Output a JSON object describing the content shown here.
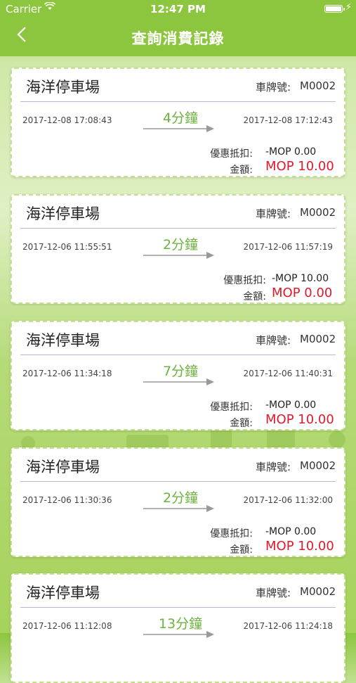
{
  "status": {
    "carrier": "Carrier",
    "time": "12:47 PM"
  },
  "nav": {
    "title": "查詢消費記錄",
    "back_icon": "chevron-left-icon"
  },
  "labels": {
    "plate": "車牌號:",
    "discount": "優惠抵扣:",
    "amount": "金額:"
  },
  "colors": {
    "brand": "#8cc63f",
    "duration": "#6db33f",
    "amount": "#e2182b"
  },
  "records": [
    {
      "name": "海洋停車場",
      "plate": "M0002",
      "start": "2017-12-08 17:08:43",
      "end": "2017-12-08 17:12:43",
      "duration": "4分鐘",
      "discount": "-MOP 0.00",
      "amount": "MOP 10.00"
    },
    {
      "name": "海洋停車場",
      "plate": "M0002",
      "start": "2017-12-06 11:55:51",
      "end": "2017-12-06 11:57:19",
      "duration": "2分鐘",
      "discount": "-MOP 10.00",
      "amount": "MOP 0.00"
    },
    {
      "name": "海洋停車場",
      "plate": "M0002",
      "start": "2017-12-06 11:34:18",
      "end": "2017-12-06 11:40:31",
      "duration": "7分鐘",
      "discount": "-MOP 0.00",
      "amount": "MOP 10.00"
    },
    {
      "name": "海洋停車場",
      "plate": "M0002",
      "start": "2017-12-06 11:30:36",
      "end": "2017-12-06 11:32:00",
      "duration": "2分鐘",
      "discount": "-MOP 0.00",
      "amount": "MOP 10.00"
    },
    {
      "name": "海洋停車場",
      "plate": "M0002",
      "start": "2017-12-06 11:12:08",
      "end": "2017-12-06 11:24:18",
      "duration": "13分鐘",
      "discount": "",
      "amount": ""
    }
  ]
}
